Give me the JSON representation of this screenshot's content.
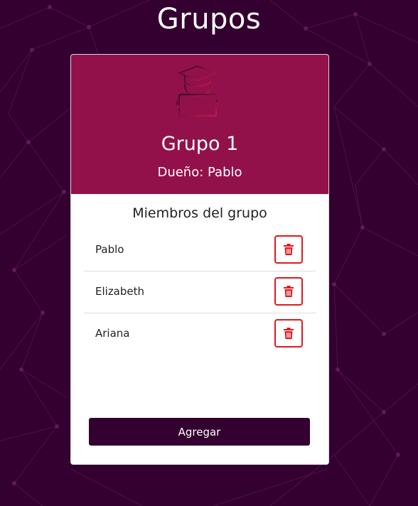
{
  "page": {
    "title": "Grupos"
  },
  "group": {
    "name": "Grupo 1",
    "owner": "Dueño: Pablo",
    "icon": "student-reading-icon"
  },
  "members": {
    "title": "Miembros del grupo",
    "items": [
      {
        "name": "Pablo"
      },
      {
        "name": "Elizabeth"
      },
      {
        "name": "Ariana"
      }
    ],
    "delete_icon": "trash-icon"
  },
  "actions": {
    "add_label": "Agregar"
  },
  "colors": {
    "background": "#33002f",
    "header": "#93114b",
    "danger": "#e0191f",
    "primary_button": "#33002f"
  }
}
